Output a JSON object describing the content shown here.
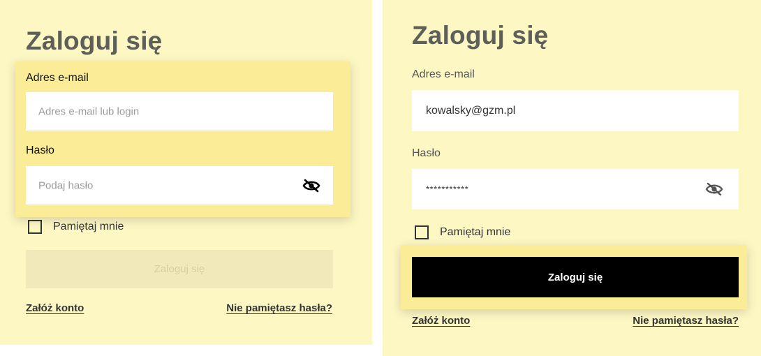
{
  "left_form": {
    "title": "Zaloguj się",
    "email": {
      "label": "Adres e-mail",
      "placeholder": "Adres e-mail lub login",
      "value": ""
    },
    "password": {
      "label": "Hasło",
      "placeholder": "Podaj hasło",
      "value": ""
    },
    "remember_label": "Pamiętaj mnie",
    "remember_checked": false,
    "submit_label": "Zaloguj się",
    "submit_enabled": false,
    "create_account_label": "Załóż konto",
    "forgot_password_label": "Nie pamiętasz hasła?"
  },
  "right_form": {
    "title": "Zaloguj się",
    "email": {
      "label": "Adres e-mail",
      "placeholder": "",
      "value": "kowalsky@gzm.pl"
    },
    "password": {
      "label": "Hasło",
      "placeholder": "",
      "value": "***********"
    },
    "remember_label": "Pamiętaj mnie",
    "remember_checked": false,
    "submit_label": "Zaloguj się",
    "submit_enabled": true,
    "create_account_label": "Załóż konto",
    "forgot_password_label": "Nie pamiętasz hasła?"
  },
  "icons": {
    "password_toggle": "eye-slash-icon"
  },
  "colors": {
    "panel_background": "#fdf7c3",
    "highlight": "#fbed98",
    "title": "#5f5f5a",
    "button_active": "#000000",
    "button_disabled": "#f1e9b9"
  }
}
